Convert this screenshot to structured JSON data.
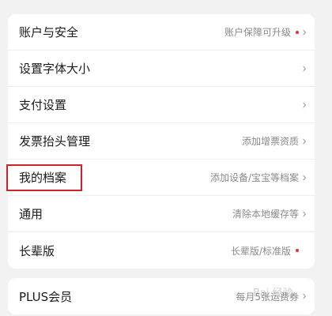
{
  "settings": [
    {
      "label": "账户与安全",
      "hint": "账户保障可升级",
      "dot": true
    },
    {
      "label": "设置字体大小",
      "hint": "",
      "dot": false
    },
    {
      "label": "支付设置",
      "hint": "",
      "dot": false
    },
    {
      "label": "发票抬头管理",
      "hint": "添加增票资质",
      "dot": false
    },
    {
      "label": "我的档案",
      "hint": "添加设备/宝宝等档案",
      "dot": false
    },
    {
      "label": "通用",
      "hint": "清除本地缓存等",
      "dot": false
    },
    {
      "label": "长辈版",
      "hint": "长辈版/标准版",
      "dot": true
    }
  ],
  "plus": {
    "label": "PLUS会员",
    "hint": "每月5张运费券"
  },
  "chevron": "›",
  "watermark": "Bai 经验",
  "colors": {
    "dot": "#e0303a",
    "highlight": "#d3202e"
  },
  "icons": {
    "chevron": "chevron-right-icon"
  }
}
